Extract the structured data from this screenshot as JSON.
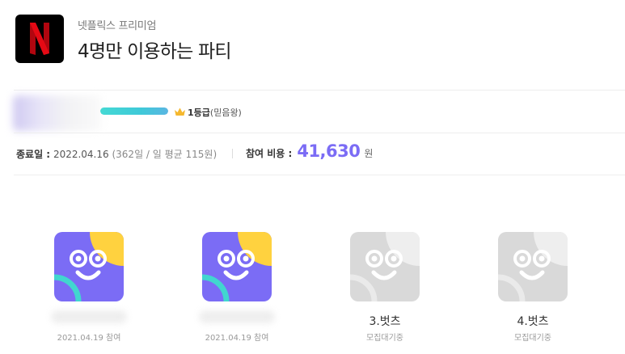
{
  "header": {
    "logo_letter": "N",
    "subtitle": "넷플릭스 프리미엄",
    "title": "4명만 이용하는 파티"
  },
  "leader": {
    "progress": 1.0,
    "grade_bold": "1등급",
    "grade_desc": "(믿음왕)"
  },
  "info": {
    "end_label": "종료일 :",
    "end_date": "2022.04.16",
    "end_detail": "(362일 / 일 평균 115원)",
    "fee_label": "참여 비용 :",
    "fee_amount": "41,630",
    "fee_unit": "원"
  },
  "members": [
    {
      "status": "joined",
      "name": "",
      "sub": "2021.04.19 참여"
    },
    {
      "status": "joined",
      "name": "",
      "sub": "2021.04.19 참여"
    },
    {
      "status": "waiting",
      "name": "3.벗츠",
      "sub": "모집대기중"
    },
    {
      "status": "waiting",
      "name": "4.벗츠",
      "sub": "모집대기중"
    }
  ],
  "colors": {
    "accent": "#7b6cf5",
    "brand_red": "#e50914",
    "avatar_purple": "#7b6cf5",
    "avatar_yellow": "#ffd23f",
    "avatar_teal": "#41d6cf",
    "avatar_gray": "#d9d9d9"
  },
  "icons": [
    "netflix-logo",
    "crown-icon",
    "smile-avatar-icon"
  ]
}
